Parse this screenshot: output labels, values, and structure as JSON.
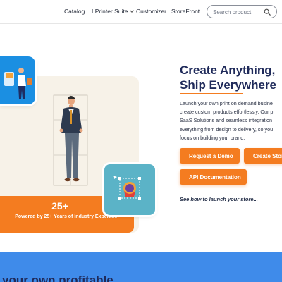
{
  "nav": {
    "items": [
      {
        "label": "Catalog"
      },
      {
        "label": "LPrinter Suite"
      },
      {
        "label": "Customizer"
      },
      {
        "label": "StoreFront"
      }
    ]
  },
  "search": {
    "placeholder": "Search product",
    "icon": "search-icon"
  },
  "hero": {
    "title_line1": "Create Anything,",
    "title_line2": "Ship Everywhere",
    "description_lines": [
      "Launch your own print on demand busine",
      "create custom products effortlessly. Our p",
      "SaaS Solutions and seamless integration",
      "everything from design to delivery, so you",
      "focus on building your brand."
    ],
    "buttons": {
      "demo": "Request a Demo",
      "store": "Create Stor",
      "api": "API Documentation"
    },
    "see_how": "See how to launch your store..."
  },
  "stats": {
    "number": "25+",
    "caption": "Powered by 25+ Years of Industry Expertise!"
  },
  "section2": {
    "heading": "your own profitable"
  },
  "colors": {
    "accent": "#f47c20",
    "navy": "#1f2a5a",
    "blue_band": "#3f8bea",
    "beige": "#f7f2e8",
    "card_blue": "#1b8fe2",
    "card_teal": "#5bb3c7"
  }
}
